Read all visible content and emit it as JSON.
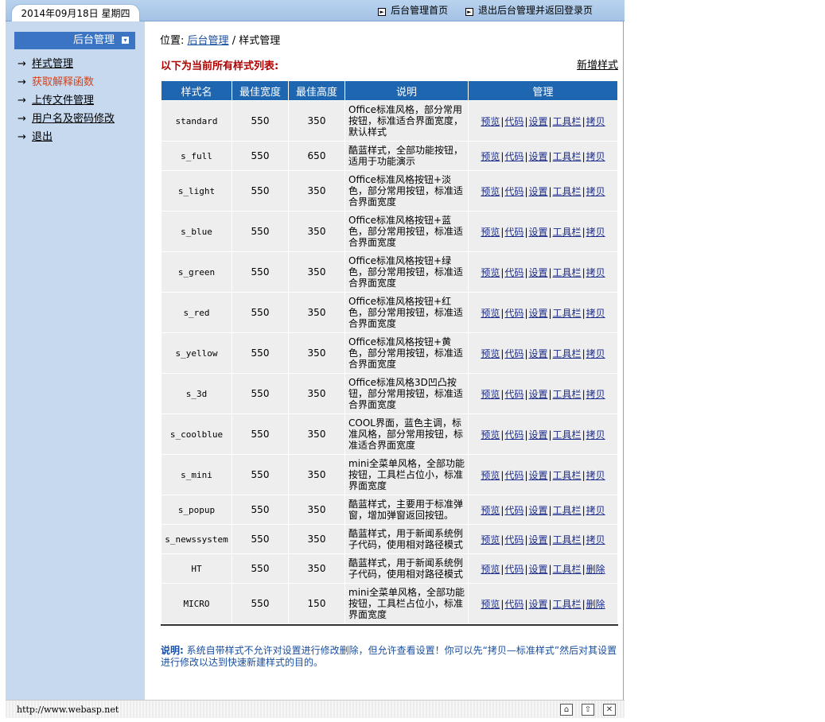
{
  "header": {
    "date": "2014年09月18日  星期四",
    "links": [
      {
        "label": "后台管理首页",
        "icon": "arrow-square-icon"
      },
      {
        "label": "退出后台管理并返回登录页",
        "icon": "arrow-square-icon"
      }
    ]
  },
  "sidebar": {
    "title": "后台管理",
    "items": [
      {
        "label": "样式管理"
      },
      {
        "label": "获取解释函数"
      },
      {
        "label": "上传文件管理"
      },
      {
        "label": "用户名及密码修改"
      },
      {
        "label": "退出"
      }
    ]
  },
  "breadcrumb": {
    "prefix": "位置:",
    "link": "后台管理",
    "sep": "/",
    "current": "样式管理"
  },
  "list": {
    "heading": "以下为当前所有样式列表:",
    "new_link": "新增样式",
    "columns": [
      "样式名",
      "最佳宽度",
      "最佳高度",
      "说明",
      "管理"
    ],
    "rows": [
      {
        "name": "standard",
        "w": "550",
        "h": "350",
        "desc": "Office标准风格，部分常用按钮，标准适合界面宽度，默认样式",
        "last": "拷贝"
      },
      {
        "name": "s_full",
        "w": "550",
        "h": "650",
        "desc": "酷蓝样式，全部功能按钮，适用于功能演示",
        "last": "拷贝"
      },
      {
        "name": "s_light",
        "w": "550",
        "h": "350",
        "desc": "Office标准风格按钮+淡色，部分常用按钮，标准适合界面宽度",
        "last": "拷贝"
      },
      {
        "name": "s_blue",
        "w": "550",
        "h": "350",
        "desc": "Office标准风格按钮+蓝色，部分常用按钮，标准适合界面宽度",
        "last": "拷贝"
      },
      {
        "name": "s_green",
        "w": "550",
        "h": "350",
        "desc": "Office标准风格按钮+绿色，部分常用按钮，标准适合界面宽度",
        "last": "拷贝"
      },
      {
        "name": "s_red",
        "w": "550",
        "h": "350",
        "desc": "Office标准风格按钮+红色，部分常用按钮，标准适合界面宽度",
        "last": "拷贝"
      },
      {
        "name": "s_yellow",
        "w": "550",
        "h": "350",
        "desc": "Office标准风格按钮+黄色，部分常用按钮，标准适合界面宽度",
        "last": "拷贝"
      },
      {
        "name": "s_3d",
        "w": "550",
        "h": "350",
        "desc": "Office标准风格3D凹凸按钮，部分常用按钮，标准适合界面宽度",
        "last": "拷贝"
      },
      {
        "name": "s_coolblue",
        "w": "550",
        "h": "350",
        "desc": "COOL界面，蓝色主调，标准风格，部分常用按钮，标准适合界面宽度",
        "last": "拷贝"
      },
      {
        "name": "s_mini",
        "w": "550",
        "h": "350",
        "desc": "mini全菜单风格，全部功能按钮，工具栏占位小，标准界面宽度",
        "last": "拷贝"
      },
      {
        "name": "s_popup",
        "w": "550",
        "h": "350",
        "desc": "酷蓝样式，主要用于标准弹窗，增加弹窗返回按钮。",
        "last": "拷贝"
      },
      {
        "name": "s_newssystem",
        "w": "550",
        "h": "350",
        "desc": "酷蓝样式，用于新闻系统例子代码，使用相对路径模式",
        "last": "拷贝"
      },
      {
        "name": "HT",
        "w": "550",
        "h": "350",
        "desc": "酷蓝样式，用于新闻系统例子代码，使用相对路径模式",
        "last": "删除"
      },
      {
        "name": "MICRO",
        "w": "550",
        "h": "150",
        "desc": "mini全菜单风格，全部功能按钮，工具栏占位小，标准界面宽度",
        "last": "删除"
      }
    ],
    "ops": [
      "预览",
      "代码",
      "设置",
      "工具栏"
    ]
  },
  "note": {
    "label": "说明:",
    "text": "系统自带样式不允许对设置进行修改删除，但允许查看设置！你可以先“拷贝—标准样式”然后对其设置进行修改以达到快速新建样式的目的。"
  },
  "statusbar": {
    "url": "http://www.webasp.net"
  },
  "colors": {
    "header_blue": "#1f66b0",
    "sidebar_bg": "#c7d9ef",
    "heading_red": "#b00000",
    "active_link": "#d2441a"
  }
}
